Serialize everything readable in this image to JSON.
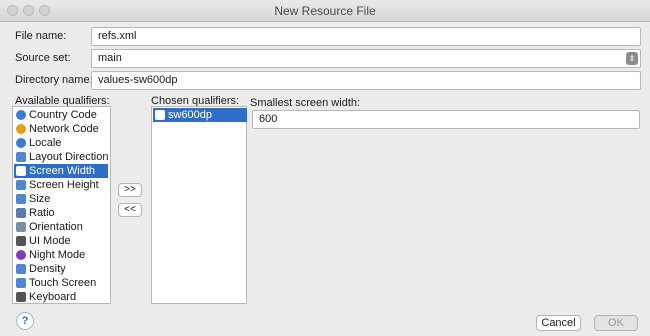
{
  "window": {
    "title": "New Resource File"
  },
  "form": {
    "file_name_label": "File name:",
    "file_name_value": "refs.xml",
    "source_set_label": "Source set:",
    "source_set_value": "main",
    "directory_label": "Directory name:",
    "directory_value": "values-sw600dp"
  },
  "qualifiers": {
    "available_label": "Available qualifiers:",
    "chosen_label": "Chosen qualifiers:",
    "available": [
      {
        "label": "Country Code",
        "icon": "globe-icon",
        "color": "#3b7bd1"
      },
      {
        "label": "Network Code",
        "icon": "network-icon",
        "color": "#e0a21a"
      },
      {
        "label": "Locale",
        "icon": "locale-icon",
        "color": "#3b7bd1"
      },
      {
        "label": "Layout Direction",
        "icon": "layout-direction-icon",
        "color": "#4f86cf"
      },
      {
        "label": "Screen Width",
        "icon": "screen-width-icon",
        "color": "#ffffff"
      },
      {
        "label": "Screen Height",
        "icon": "screen-height-icon",
        "color": "#4f86cf"
      },
      {
        "label": "Size",
        "icon": "size-icon",
        "color": "#4f86cf"
      },
      {
        "label": "Ratio",
        "icon": "ratio-icon",
        "color": "#5a7fae"
      },
      {
        "label": "Orientation",
        "icon": "orientation-icon",
        "color": "#7c8fa6"
      },
      {
        "label": "UI Mode",
        "icon": "ui-mode-icon",
        "color": "#555555"
      },
      {
        "label": "Night Mode",
        "icon": "night-mode-icon",
        "color": "#7a3fb3"
      },
      {
        "label": "Density",
        "icon": "density-icon",
        "color": "#4f86cf"
      },
      {
        "label": "Touch Screen",
        "icon": "touch-screen-icon",
        "color": "#4f86cf"
      },
      {
        "label": "Keyboard",
        "icon": "keyboard-icon",
        "color": "#555555"
      }
    ],
    "selected_index": 4,
    "chosen": [
      {
        "label": "sw600dp",
        "icon": "screen-width-icon"
      }
    ],
    "add_button": ">>",
    "remove_button": "<<"
  },
  "detail": {
    "label": "Smallest screen width:",
    "value": "600"
  },
  "footer": {
    "help": "?",
    "cancel": "Cancel",
    "ok": "OK"
  },
  "colors": {
    "selection": "#2f6ec8"
  }
}
